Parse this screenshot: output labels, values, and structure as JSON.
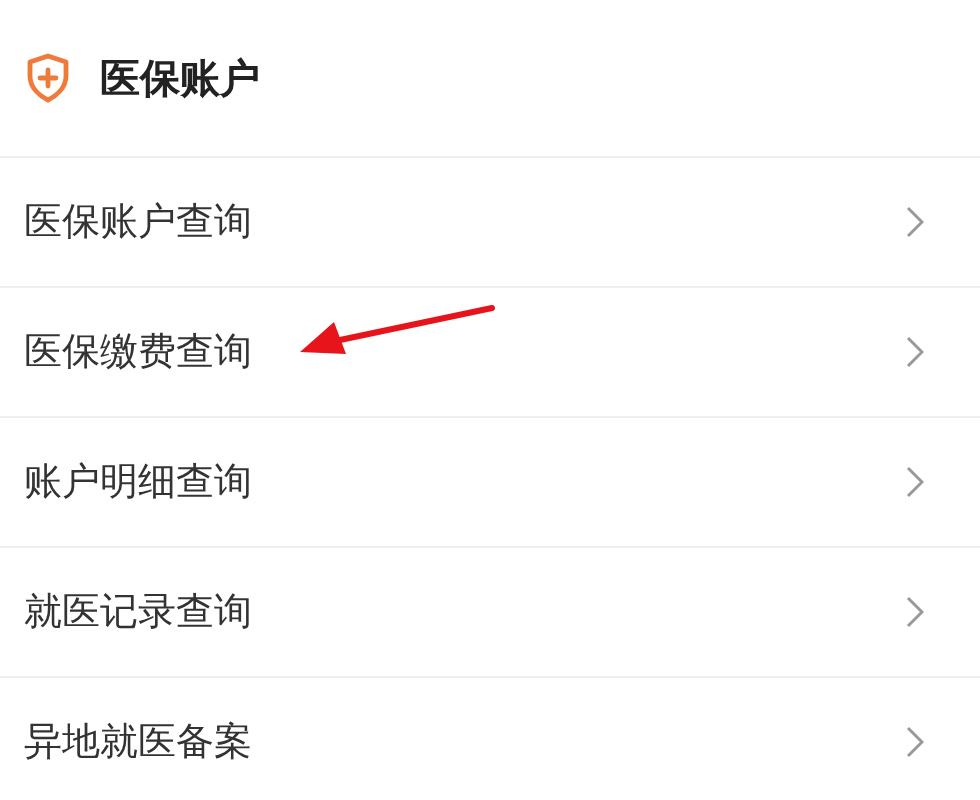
{
  "section": {
    "title": "医保账户"
  },
  "items": [
    {
      "label": "医保账户查询",
      "arrow_marked": false
    },
    {
      "label": "医保缴费查询",
      "arrow_marked": true
    },
    {
      "label": "账户明细查询",
      "arrow_marked": false
    },
    {
      "label": "就医记录查询",
      "arrow_marked": false
    },
    {
      "label": "异地就医备案",
      "arrow_marked": false
    }
  ]
}
